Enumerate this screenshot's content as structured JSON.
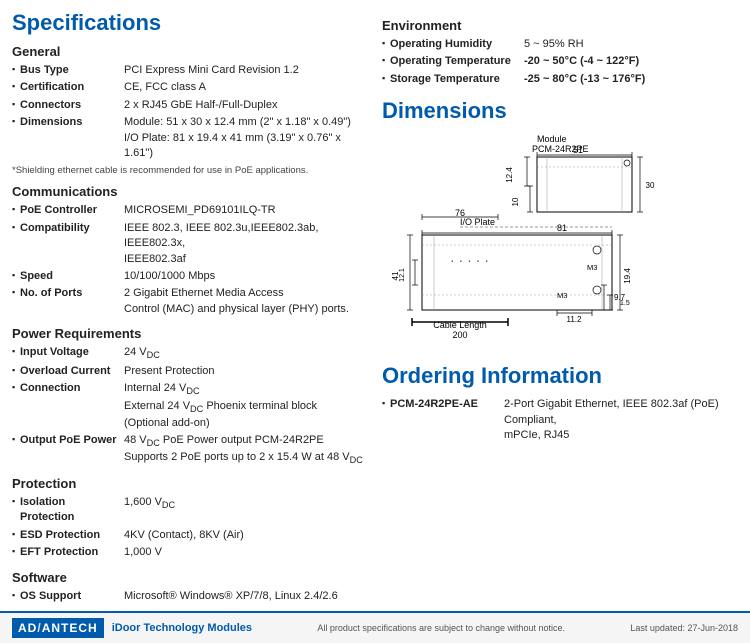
{
  "page": {
    "title": "Specifications"
  },
  "left": {
    "general": {
      "heading": "General",
      "rows": [
        {
          "label": "Bus Type",
          "value": "PCI Express Mini Card Revision 1.2"
        },
        {
          "label": "Certification",
          "value": "CE, FCC class A"
        },
        {
          "label": "Connectors",
          "value": "2 x RJ45 GbE Half-/Full-Duplex"
        },
        {
          "label": "Dimensions",
          "value": "Module: 51 x 30 x 12.4 mm (2\" x 1.18\" x 0.49\")\nI/O Plate: 81 x 19.4 x 41 mm (3.19\" x 0.76\" x 1.61\")"
        }
      ],
      "note": "*Shielding ethernet cable is recommended for use in PoE applications."
    },
    "communications": {
      "heading": "Communications",
      "rows": [
        {
          "label": "PoE Controller",
          "value": "MICROSEMI_PD69101ILQ-TR"
        },
        {
          "label": "Compatibility",
          "value": "IEEE 802.3, IEEE 802.3u,IEEE802.3ab, IEEE802.3x,\nIEEE802.3af"
        },
        {
          "label": "Speed",
          "value": "10/100/1000 Mbps"
        },
        {
          "label": "No. of Ports",
          "value": "2 Gigabit Ethernet Media Access\nControl (MAC) and physical layer (PHY) ports."
        }
      ]
    },
    "power": {
      "heading": "Power Requirements",
      "rows": [
        {
          "label": "Input Voltage",
          "value": "24 VDC"
        },
        {
          "label": "Overload Current",
          "value": "Present Protection"
        },
        {
          "label": "Connection",
          "value": "Internal 24 VDC\nExternal 24 VDC Phoenix terminal block (Optional add-on)"
        },
        {
          "label": "Output PoE Power",
          "value": "48 VDC PoE Power output PCM-24R2PE\nSupports 2 PoE ports up to 2 x 15.4 W at 48 VDC"
        }
      ]
    },
    "protection": {
      "heading": "Protection",
      "rows": [
        {
          "label": "Isolation Protection",
          "value": "1,600 VDC"
        },
        {
          "label": "ESD Protection",
          "value": "4KV (Contact), 8KV (Air)"
        },
        {
          "label": "EFT Protection",
          "value": "1,000 V"
        }
      ]
    },
    "software": {
      "heading": "Software",
      "rows": [
        {
          "label": "OS Support",
          "value": "Microsoft® Windows® XP/7/8, Linux 2.4/2.6"
        }
      ]
    }
  },
  "right": {
    "environment": {
      "heading": "Environment",
      "rows": [
        {
          "label": "Operating Humidity",
          "value": "5 ~ 95% RH"
        },
        {
          "label": "Operating Temperature",
          "value": "-20 ~ 50°C (-4 ~ 122°F)"
        },
        {
          "label": "Storage Temperature",
          "value": "-25 ~ 80°C (-13 ~ 176°F)"
        }
      ]
    },
    "dimensions": {
      "heading": "Dimensions"
    },
    "ordering": {
      "heading": "Ordering Information",
      "rows": [
        {
          "label": "PCM-24R2PE-AE",
          "value": "2-Port Gigabit Ethernet, IEEE 802.3af (PoE) Compliant,\nmPCIe, RJ45"
        }
      ]
    }
  },
  "footer": {
    "brand": "AD/ANTECH",
    "module": "iDoor Technology Modules",
    "note": "All product specifications are subject to change without notice.",
    "date": "Last updated: 27-Jun-2018"
  }
}
